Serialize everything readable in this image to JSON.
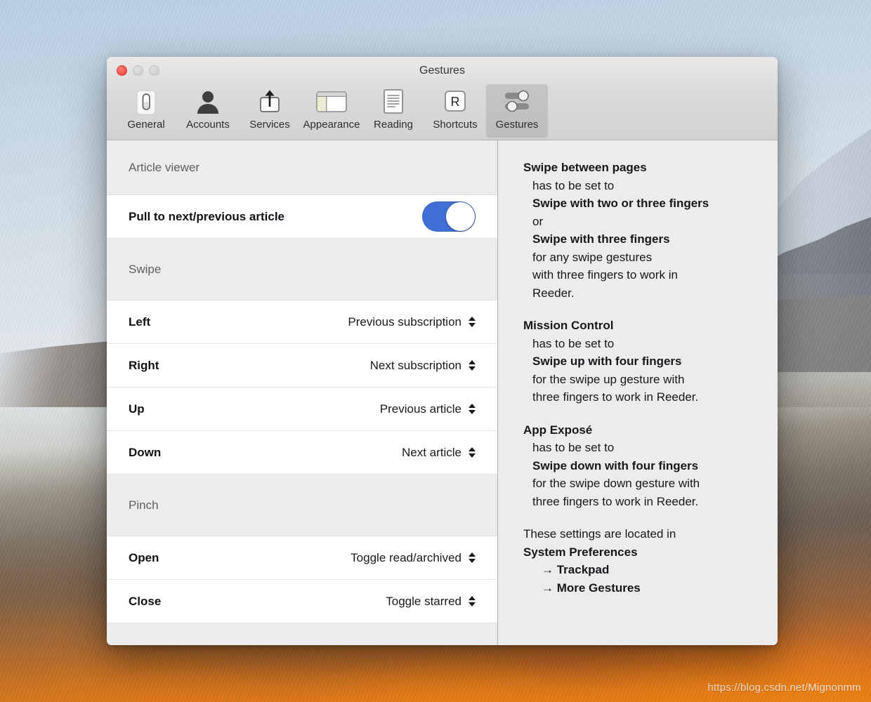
{
  "desktop": {
    "watermark": "https://blog.csdn.net/Mignonmm"
  },
  "window": {
    "title": "Gestures",
    "traffic_lights": {
      "close_label": "close",
      "minimize_label": "minimize",
      "maximize_label": "zoom"
    }
  },
  "toolbar": {
    "items": [
      {
        "label": "General",
        "icon": "switch-icon",
        "selected": false
      },
      {
        "label": "Accounts",
        "icon": "person-icon",
        "selected": false
      },
      {
        "label": "Services",
        "icon": "share-icon",
        "selected": false
      },
      {
        "label": "Appearance",
        "icon": "window-icon",
        "selected": false
      },
      {
        "label": "Reading",
        "icon": "document-icon",
        "selected": false
      },
      {
        "label": "Shortcuts",
        "icon": "key-r-icon",
        "selected": false
      },
      {
        "label": "Gestures",
        "icon": "sliders-icon",
        "selected": true
      }
    ]
  },
  "settings": {
    "sections": [
      {
        "header": "Article viewer",
        "rows": [
          {
            "label": "Pull to next/previous article",
            "control": "toggle",
            "value": "on"
          }
        ]
      },
      {
        "header": "Swipe",
        "rows": [
          {
            "label": "Left",
            "control": "popup",
            "value": "Previous subscription"
          },
          {
            "label": "Right",
            "control": "popup",
            "value": "Next subscription"
          },
          {
            "label": "Up",
            "control": "popup",
            "value": "Previous article"
          },
          {
            "label": "Down",
            "control": "popup",
            "value": "Next article"
          }
        ]
      },
      {
        "header": "Pinch",
        "rows": [
          {
            "label": "Open",
            "control": "popup",
            "value": "Toggle read/archived"
          },
          {
            "label": "Close",
            "control": "popup",
            "value": "Toggle starred"
          }
        ]
      }
    ]
  },
  "help": {
    "blocks": [
      {
        "lines": [
          {
            "text": "Swipe between pages",
            "bold": true,
            "indent": 0
          },
          {
            "text": "has to be set to",
            "bold": false,
            "indent": 1
          },
          {
            "text": "Swipe with two or three fingers",
            "bold": true,
            "indent": 1
          },
          {
            "text": "or",
            "bold": false,
            "indent": 1
          },
          {
            "text": "Swipe with three fingers",
            "bold": true,
            "indent": 1
          },
          {
            "text": "for any swipe gestures",
            "bold": false,
            "indent": 1
          },
          {
            "text": "with three fingers to work in",
            "bold": false,
            "indent": 1
          },
          {
            "text": "Reeder.",
            "bold": false,
            "indent": 1
          }
        ]
      },
      {
        "lines": [
          {
            "text": "Mission Control",
            "bold": true,
            "indent": 0
          },
          {
            "text": "has to be set to",
            "bold": false,
            "indent": 1
          },
          {
            "text": "Swipe up with four fingers",
            "bold": true,
            "indent": 1
          },
          {
            "text": "for the swipe up gesture with",
            "bold": false,
            "indent": 1
          },
          {
            "text": "three fingers to work in Reeder.",
            "bold": false,
            "indent": 1
          }
        ]
      },
      {
        "lines": [
          {
            "text": "App Exposé",
            "bold": true,
            "indent": 0
          },
          {
            "text": "has to be set to",
            "bold": false,
            "indent": 1
          },
          {
            "text": "Swipe down with four fingers",
            "bold": true,
            "indent": 1
          },
          {
            "text": "for the swipe down gesture with",
            "bold": false,
            "indent": 1
          },
          {
            "text": "three fingers to work in Reeder.",
            "bold": false,
            "indent": 1
          }
        ]
      },
      {
        "lines": [
          {
            "text": "These settings are located in",
            "bold": false,
            "indent": 0
          },
          {
            "text": "System Preferences",
            "bold": true,
            "indent": 0
          },
          {
            "text": "→ Trackpad",
            "bold": true,
            "indent": 2
          },
          {
            "text": "→ More Gestures",
            "bold": true,
            "indent": 2
          }
        ]
      }
    ]
  },
  "colors": {
    "toggle_on": "#3f6fd4",
    "window_chrome": "#dcdcdc",
    "section_header_bg": "#ececec",
    "row_bg": "#ffffff"
  }
}
